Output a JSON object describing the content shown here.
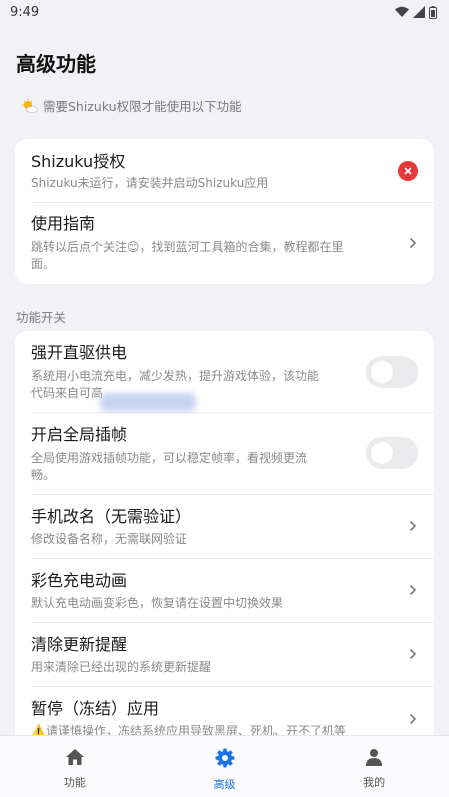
{
  "status_bar": {
    "time": "9:49"
  },
  "header": {
    "title": "高级功能"
  },
  "notice": {
    "text": "需要Shizuku权限才能使用以下功能"
  },
  "card_top": [
    {
      "title": "Shizuku授权",
      "subtitle": "Shizuku未运行，请安装并启动Shizuku应用",
      "control": "error-badge"
    },
    {
      "title": "使用指南",
      "subtitle_line1": "跳转以后点个关注😊，找到蓝河工具箱的合集，教程都在里",
      "subtitle_line2": "面。",
      "control": "chevron"
    }
  ],
  "section": {
    "label": "功能开关"
  },
  "features": [
    {
      "title": "强开直驱供电",
      "subtitle_line1": "系统用小电流充电，减少发热，提升游戏体验，该功能",
      "subtitle_line2": "代码来自可高",
      "control": "toggle",
      "enabled": false
    },
    {
      "title": "开启全局插帧",
      "subtitle_line1": "全局使用游戏插帧功能，可以稳定帧率，看视频更流",
      "subtitle_line2": "畅。",
      "control": "toggle",
      "enabled": false
    },
    {
      "title": "手机改名（无需验证）",
      "subtitle": "修改设备名称，无需联网验证",
      "control": "chevron"
    },
    {
      "title": "彩色充电动画",
      "subtitle": "默认充电动画变彩色，恢复请在设置中切换效果",
      "control": "chevron"
    },
    {
      "title": "清除更新提醒",
      "subtitle": "用来清除已经出现的系统更新提醒",
      "control": "chevron"
    },
    {
      "title": "暂停（冻结）应用",
      "subtitle": "⚠️请谨慎操作，冻结系统应用导致黑屏、死机、开不了机等",
      "control": "chevron"
    }
  ],
  "bottom_nav": [
    {
      "label": "功能",
      "icon": "home-icon",
      "active": false
    },
    {
      "label": "高级",
      "icon": "gear-icon",
      "active": true
    },
    {
      "label": "我的",
      "icon": "person-icon",
      "active": false
    }
  ],
  "colors": {
    "accent": "#1a73e8",
    "error": "#e8373a",
    "background": "#f2f2f6"
  }
}
